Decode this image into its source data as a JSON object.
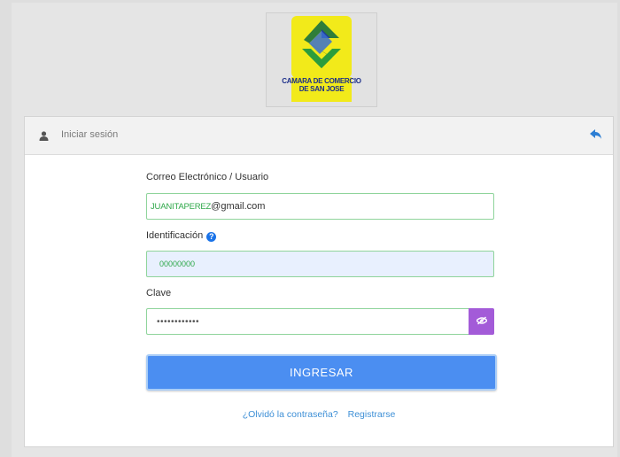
{
  "logo": {
    "line1": "CAMARA DE COMERCIO",
    "line2": "DE SAN JOSE"
  },
  "header": {
    "title": "Iniciar sesión",
    "user_icon": "user-icon",
    "back_icon": "reply-arrow-icon"
  },
  "form": {
    "email_label": "Correo Electrónico / Usuario",
    "email_user": "JUANITAPEREZ",
    "email_domain": "@gmail.com",
    "id_label": "Identificación",
    "id_info_icon": "?",
    "id_value": "00000000",
    "password_label": "Clave",
    "password_value": "••••••••••••",
    "show_password_icon": "eye-slash-icon",
    "submit_label": "INGRESAR"
  },
  "links": {
    "forgot": "¿Olvidó la contraseña?",
    "register": "Registrarse"
  },
  "colors": {
    "accent": "#4b8ef1",
    "field_border": "#8fd49b",
    "eye_button": "#a35bd8",
    "link": "#3d8fd6"
  }
}
